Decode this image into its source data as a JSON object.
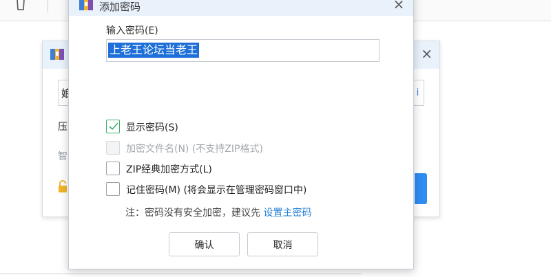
{
  "dialog": {
    "title": "添加密码",
    "close_glyph": "×",
    "password_label": "输入密码(E)",
    "password_value": "上老王论坛当老王",
    "options": [
      {
        "label": "显示密码(S)",
        "checked": true,
        "disabled": false
      },
      {
        "label": "加密文件名(N) (不支持ZIP格式)",
        "checked": false,
        "disabled": true
      },
      {
        "label": "ZIP经典加密方式(L)",
        "checked": false,
        "disabled": false
      },
      {
        "label": "记住密码(M) (将会显示在管理密码窗口中)",
        "checked": false,
        "disabled": false
      }
    ],
    "note_text": "注：密码没有安全加密，建议先 ",
    "note_link": "设置主密码",
    "ok_label": "确认",
    "cancel_label": "取消"
  },
  "background": {
    "close_glyph": "×",
    "field_char": "娘",
    "field_right_char": "i",
    "text1": "压",
    "text2": "智"
  },
  "icons": [
    "trash-icon",
    "archive-icon",
    "close-icon",
    "check-icon",
    "lock-icon"
  ],
  "colors": {
    "accent": "#1f7fd6",
    "selection": "#1e6fd9",
    "check": "#3ab06a",
    "title_bar": "#e9f1fb"
  }
}
